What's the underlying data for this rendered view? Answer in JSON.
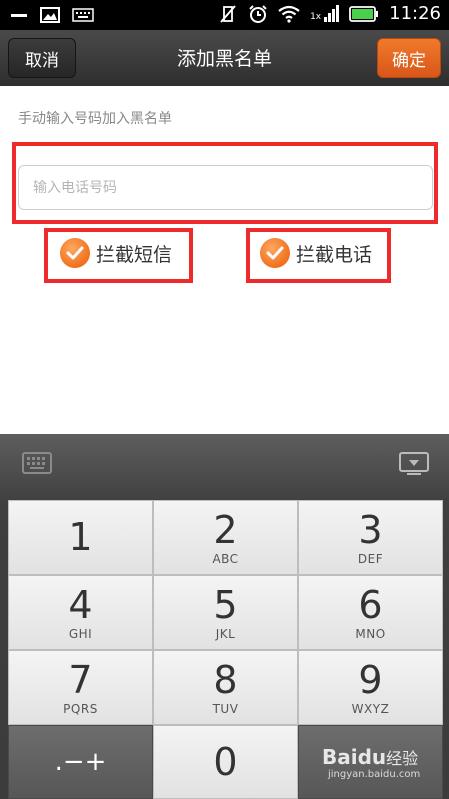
{
  "status_bar": {
    "time": "11:26",
    "signal_tag": "1x"
  },
  "header": {
    "cancel_label": "取消",
    "title": "添加黑名单",
    "confirm_label": "确定"
  },
  "main": {
    "hint": "手动输入号码加入黑名单",
    "phone_input": {
      "value": "",
      "placeholder": "输入电话号码"
    },
    "options": [
      {
        "label": "拦截短信",
        "checked": true
      },
      {
        "label": "拦截电话",
        "checked": true
      }
    ]
  },
  "keypad": {
    "keys": [
      {
        "digit": "1",
        "letters": ""
      },
      {
        "digit": "2",
        "letters": "ABC"
      },
      {
        "digit": "3",
        "letters": "DEF"
      },
      {
        "digit": "4",
        "letters": "GHI"
      },
      {
        "digit": "5",
        "letters": "JKL"
      },
      {
        "digit": "6",
        "letters": "MNO"
      },
      {
        "digit": "7",
        "letters": "PQRS"
      },
      {
        "digit": "8",
        "letters": "TUV"
      },
      {
        "digit": "9",
        "letters": "WXYZ"
      }
    ],
    "symbols_label": ".−+",
    "zero": "0"
  },
  "watermark": {
    "brand": "Baidu",
    "cn": "经验",
    "url": "jingyan.baidu.com"
  },
  "colors": {
    "accent": "#e8641f",
    "highlight": "#ee2b2b",
    "status_bg": "#000000"
  }
}
